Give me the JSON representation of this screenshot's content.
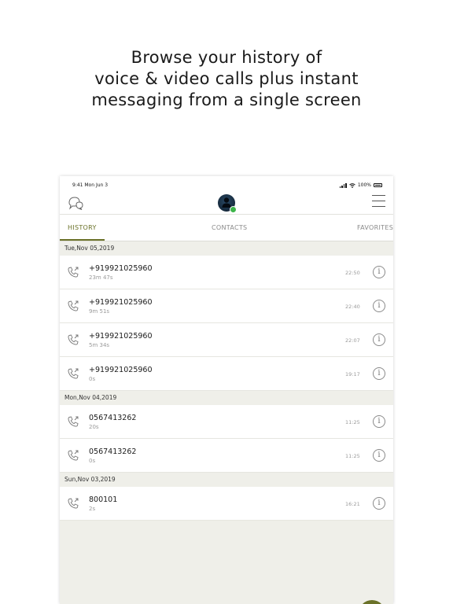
{
  "headline": {
    "line1": "Browse your history of",
    "line2": "voice & video calls plus instant",
    "line3": "messaging from a single screen"
  },
  "statusbar": {
    "time": "9:41  Mon Jun 3",
    "battery": "100%"
  },
  "toolbar": {
    "left_icon": "chat-bubbles-icon",
    "avatar_status": "online",
    "right_icon": "hamburger-menu-icon"
  },
  "tabs": {
    "history": "HISTORY",
    "contacts": "CONTACTS",
    "favorites": "FAVORITES",
    "active": "history"
  },
  "colors": {
    "accent": "#6a7128",
    "presence": "#3db54a",
    "background": "#efefe9"
  },
  "groups": [
    {
      "date": "Tue,Nov 05,2019",
      "calls": [
        {
          "number": "+919921025960",
          "duration": "23m 47s",
          "time": "22:50"
        },
        {
          "number": "+919921025960",
          "duration": "9m 51s",
          "time": "22:40"
        },
        {
          "number": "+919921025960",
          "duration": "5m 34s",
          "time": "22:07"
        },
        {
          "number": "+919921025960",
          "duration": "0s",
          "time": "19:17"
        }
      ]
    },
    {
      "date": "Mon,Nov 04,2019",
      "calls": [
        {
          "number": "0567413262",
          "duration": "20s",
          "time": "11:25"
        },
        {
          "number": "0567413262",
          "duration": "0s",
          "time": "11:25"
        }
      ]
    },
    {
      "date": "Sun,Nov 03,2019",
      "calls": [
        {
          "number": "800101",
          "duration": "2s",
          "time": "16:21"
        }
      ]
    }
  ],
  "row_icons": {
    "call": "outgoing-call-icon",
    "info": "info-icon",
    "info_glyph": "i"
  }
}
